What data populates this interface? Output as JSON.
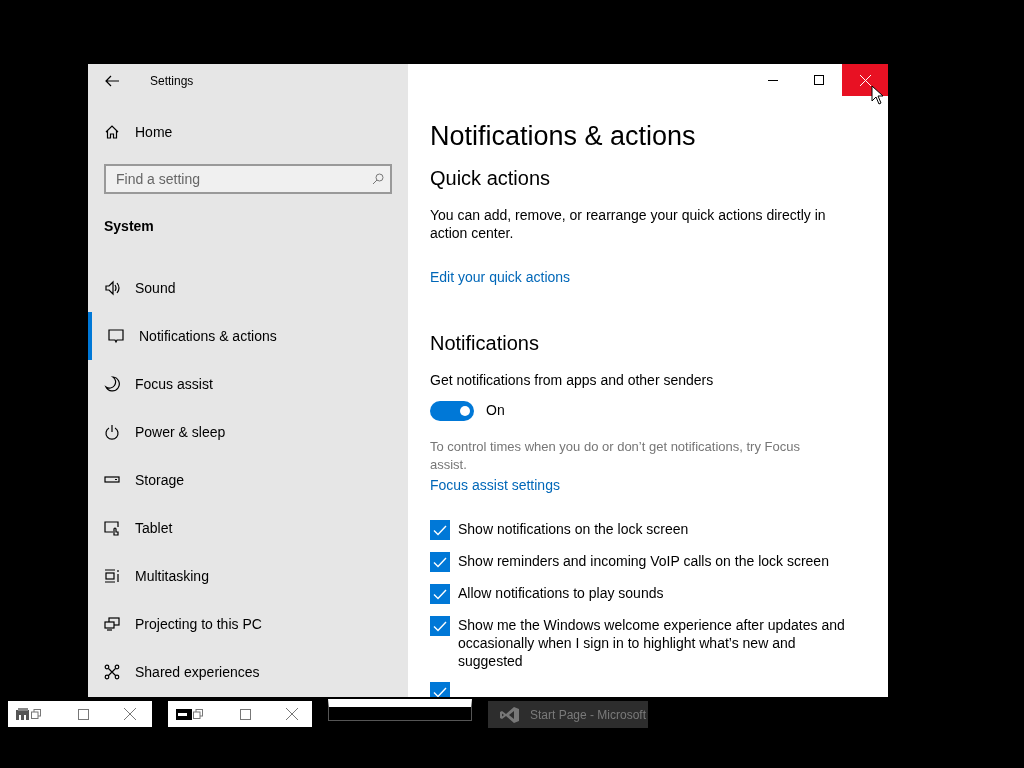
{
  "window": {
    "title": "Settings"
  },
  "sidebar": {
    "home": "Home",
    "search": {
      "placeholder": "Find a setting"
    },
    "section": "System",
    "items": [
      {
        "label": "Sound",
        "selected": false
      },
      {
        "label": "Notifications & actions",
        "selected": true
      },
      {
        "label": "Focus assist",
        "selected": false
      },
      {
        "label": "Power & sleep",
        "selected": false
      },
      {
        "label": "Storage",
        "selected": false
      },
      {
        "label": "Tablet",
        "selected": false
      },
      {
        "label": "Multitasking",
        "selected": false
      },
      {
        "label": "Projecting to this PC",
        "selected": false
      },
      {
        "label": "Shared experiences",
        "selected": false
      }
    ]
  },
  "page": {
    "title": "Notifications & actions",
    "quick_actions": {
      "heading": "Quick actions",
      "description": "You can add, remove, or rearrange your quick actions directly in action center.",
      "link": "Edit your quick actions"
    },
    "notifications": {
      "heading": "Notifications",
      "toggle_label": "Get notifications from apps and other senders",
      "toggle": {
        "on": true,
        "state_text": "On"
      },
      "hint": "To control times when you do or don’t get notifications, try Focus assist.",
      "link": "Focus assist settings",
      "options": [
        {
          "label": "Show notifications on the lock screen",
          "checked": true
        },
        {
          "label": "Show reminders and incoming VoIP calls on the lock screen",
          "checked": true
        },
        {
          "label": "Allow notifications to play sounds",
          "checked": true
        },
        {
          "label": "Show me the Windows welcome experience after updates and occasionally when I sign in to highlight what’s new and suggested",
          "checked": true
        },
        {
          "checked": true
        }
      ]
    }
  },
  "minimized_windows": [
    {
      "kind": "mini"
    },
    {
      "kind": "mini"
    },
    {
      "kind": "blank"
    },
    {
      "kind": "task",
      "label": "Start Page - Microsoft"
    }
  ]
}
